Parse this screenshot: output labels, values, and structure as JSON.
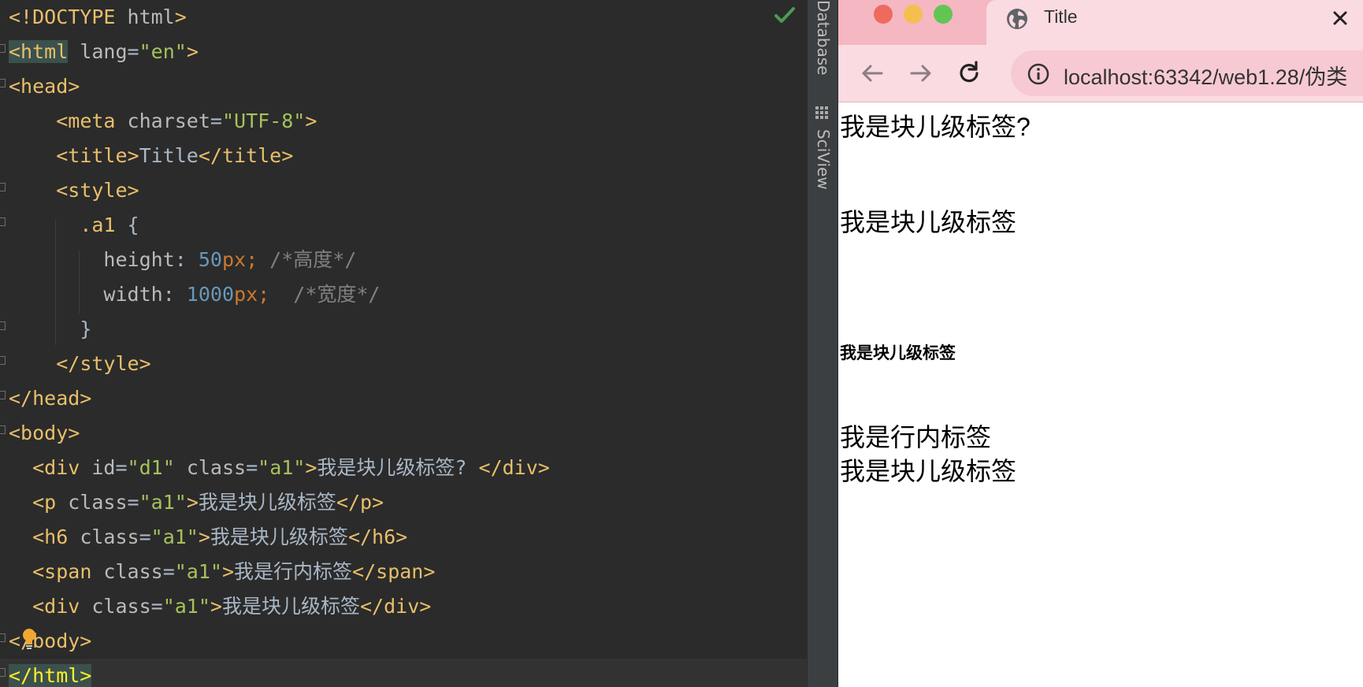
{
  "editor": {
    "lines": [
      {
        "tokens": [
          {
            "t": "<!DOCTYPE",
            "c": "tag"
          },
          {
            "t": " html",
            "c": "attr"
          },
          {
            "t": ">",
            "c": "tag"
          }
        ]
      },
      {
        "tokens": [
          {
            "t": "<html",
            "c": "hl-html"
          },
          {
            "t": " lang",
            "c": "attr"
          },
          {
            "t": "=",
            "c": "text"
          },
          {
            "t": "\"en\"",
            "c": "val"
          },
          {
            "t": ">",
            "c": "tag"
          }
        ]
      },
      {
        "tokens": [
          {
            "t": "<head>",
            "c": "tag"
          }
        ]
      },
      {
        "tokens": [
          {
            "t": "    ",
            "c": "text"
          },
          {
            "t": "<meta",
            "c": "tag"
          },
          {
            "t": " charset",
            "c": "attr"
          },
          {
            "t": "=",
            "c": "text"
          },
          {
            "t": "\"UTF-8\"",
            "c": "val"
          },
          {
            "t": ">",
            "c": "tag"
          }
        ]
      },
      {
        "tokens": [
          {
            "t": "    ",
            "c": "text"
          },
          {
            "t": "<title>",
            "c": "tag"
          },
          {
            "t": "Title",
            "c": "text"
          },
          {
            "t": "</title>",
            "c": "tag"
          }
        ]
      },
      {
        "tokens": [
          {
            "t": "    ",
            "c": "text"
          },
          {
            "t": "<style>",
            "c": "tag"
          }
        ]
      },
      {
        "tokens": [
          {
            "t": "      ",
            "c": "text"
          },
          {
            "t": ".a1",
            "c": "sel"
          },
          {
            "t": " {",
            "c": "text"
          }
        ]
      },
      {
        "tokens": [
          {
            "t": "        ",
            "c": "text"
          },
          {
            "t": "height",
            "c": "attr"
          },
          {
            "t": ": ",
            "c": "text"
          },
          {
            "t": "50",
            "c": "num"
          },
          {
            "t": "px",
            "c": "punct"
          },
          {
            "t": "; ",
            "c": "punct"
          },
          {
            "t": "/*高度*/",
            "c": "comment"
          }
        ]
      },
      {
        "tokens": [
          {
            "t": "        ",
            "c": "text"
          },
          {
            "t": "width",
            "c": "attr"
          },
          {
            "t": ": ",
            "c": "text"
          },
          {
            "t": "1000",
            "c": "num"
          },
          {
            "t": "px",
            "c": "punct"
          },
          {
            "t": ";  ",
            "c": "punct"
          },
          {
            "t": "/*宽度*/",
            "c": "comment"
          }
        ]
      },
      {
        "tokens": [
          {
            "t": "      ",
            "c": "text"
          },
          {
            "t": "}",
            "c": "text"
          }
        ]
      },
      {
        "tokens": [
          {
            "t": "    ",
            "c": "text"
          },
          {
            "t": "</style>",
            "c": "tag"
          }
        ]
      },
      {
        "tokens": [
          {
            "t": "</head>",
            "c": "tag"
          }
        ]
      },
      {
        "tokens": [
          {
            "t": "<body>",
            "c": "tag"
          }
        ]
      },
      {
        "tokens": [
          {
            "t": "  ",
            "c": "text"
          },
          {
            "t": "<div",
            "c": "tag"
          },
          {
            "t": " id",
            "c": "attr"
          },
          {
            "t": "=",
            "c": "text"
          },
          {
            "t": "\"d1\"",
            "c": "val"
          },
          {
            "t": " class",
            "c": "attr"
          },
          {
            "t": "=",
            "c": "text"
          },
          {
            "t": "\"a1\"",
            "c": "val"
          },
          {
            "t": ">",
            "c": "tag"
          },
          {
            "t": "我是块儿级标签? ",
            "c": "text"
          },
          {
            "t": "</div>",
            "c": "tag"
          }
        ]
      },
      {
        "tokens": [
          {
            "t": "  ",
            "c": "text"
          },
          {
            "t": "<p",
            "c": "tag"
          },
          {
            "t": " class",
            "c": "attr"
          },
          {
            "t": "=",
            "c": "text"
          },
          {
            "t": "\"a1\"",
            "c": "val"
          },
          {
            "t": ">",
            "c": "tag"
          },
          {
            "t": "我是块儿级标签",
            "c": "text"
          },
          {
            "t": "</p>",
            "c": "tag"
          }
        ]
      },
      {
        "tokens": [
          {
            "t": "  ",
            "c": "text"
          },
          {
            "t": "<h6",
            "c": "tag"
          },
          {
            "t": " class",
            "c": "attr"
          },
          {
            "t": "=",
            "c": "text"
          },
          {
            "t": "\"a1\"",
            "c": "val"
          },
          {
            "t": ">",
            "c": "tag"
          },
          {
            "t": "我是块儿级标签",
            "c": "text"
          },
          {
            "t": "</h6>",
            "c": "tag"
          }
        ]
      },
      {
        "tokens": [
          {
            "t": "  ",
            "c": "text"
          },
          {
            "t": "<span",
            "c": "tag"
          },
          {
            "t": " class",
            "c": "attr"
          },
          {
            "t": "=",
            "c": "text"
          },
          {
            "t": "\"a1\"",
            "c": "val"
          },
          {
            "t": ">",
            "c": "tag"
          },
          {
            "t": "我是行内标签",
            "c": "text"
          },
          {
            "t": "</span>",
            "c": "tag"
          }
        ]
      },
      {
        "tokens": [
          {
            "t": "  ",
            "c": "text"
          },
          {
            "t": "<div",
            "c": "tag"
          },
          {
            "t": " class",
            "c": "attr"
          },
          {
            "t": "=",
            "c": "text"
          },
          {
            "t": "\"a1\"",
            "c": "val"
          },
          {
            "t": ">",
            "c": "tag"
          },
          {
            "t": "我是块儿级标签",
            "c": "text"
          },
          {
            "t": "</div>",
            "c": "tag"
          }
        ]
      },
      {
        "tokens": [
          {
            "t": "</body>",
            "c": "tag"
          }
        ]
      },
      {
        "tokens": [
          {
            "t": "</html>",
            "c": "hl-html-strong"
          }
        ]
      }
    ],
    "status_icon": "check-icon",
    "hint_icon": "lightbulb-icon"
  },
  "tool_strip": {
    "tabs": [
      "Database",
      "SciView"
    ],
    "sciview_icon": "grid-icon"
  },
  "browser": {
    "tab_title": "Title",
    "tab_icon": "globe-icon",
    "url": "localhost:63342/web1.28/伪类",
    "page": {
      "div_d1": "我是块儿级标签?",
      "p": "我是块儿级标签",
      "h6": "我是块儿级标签",
      "span": "我是行内标签",
      "div": "我是块儿级标签"
    },
    "colors": {
      "titlebar": "#f5b7c2",
      "toolbar": "#fadbe1",
      "close": "#ee6a5e",
      "minimize": "#f5bf4f",
      "maximize": "#61c554"
    }
  },
  "colors": {
    "editor_bg": "#2b2b2b",
    "tag": "#e8bf6a",
    "string": "#a5c25c",
    "number": "#6897bb",
    "comment": "#808080"
  }
}
